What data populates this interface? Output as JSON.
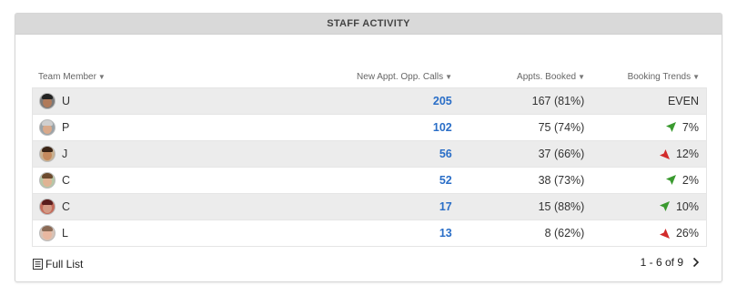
{
  "widget": {
    "title": "STAFF ACTIVITY"
  },
  "table": {
    "columns": [
      {
        "label": "Team Member",
        "sort_icon": "sort-down-icon"
      },
      {
        "label": "New Appt. Opp. Calls",
        "sort_icon": "sort-down-icon"
      },
      {
        "label": "Appts. Booked",
        "sort_icon": "sort-down-icon"
      },
      {
        "label": "Booking Trends",
        "sort_icon": "sort-down-icon"
      }
    ],
    "rows": [
      {
        "name": "U",
        "calls": "205",
        "booked": "167 (81%)",
        "trend": "EVEN",
        "direction": "even"
      },
      {
        "name": "P",
        "calls": "102",
        "booked": "75 (74%)",
        "trend": "7%",
        "direction": "up"
      },
      {
        "name": "J",
        "calls": "56",
        "booked": "37 (66%)",
        "trend": "12%",
        "direction": "down"
      },
      {
        "name": "C",
        "calls": "52",
        "booked": "38 (73%)",
        "trend": "2%",
        "direction": "up"
      },
      {
        "name": "C",
        "calls": "17",
        "booked": "15 (88%)",
        "trend": "10%",
        "direction": "up"
      },
      {
        "name": "L",
        "calls": "13",
        "booked": "8 (62%)",
        "trend": "26%",
        "direction": "down"
      }
    ]
  },
  "footer": {
    "full_list_label": "Full List",
    "pagination": "1 - 6 of 9"
  },
  "colors": {
    "link": "#2a6ec7",
    "trend_up": "#3a9a2f",
    "trend_down": "#d22b2b",
    "header_bg": "#d9d9d9"
  }
}
